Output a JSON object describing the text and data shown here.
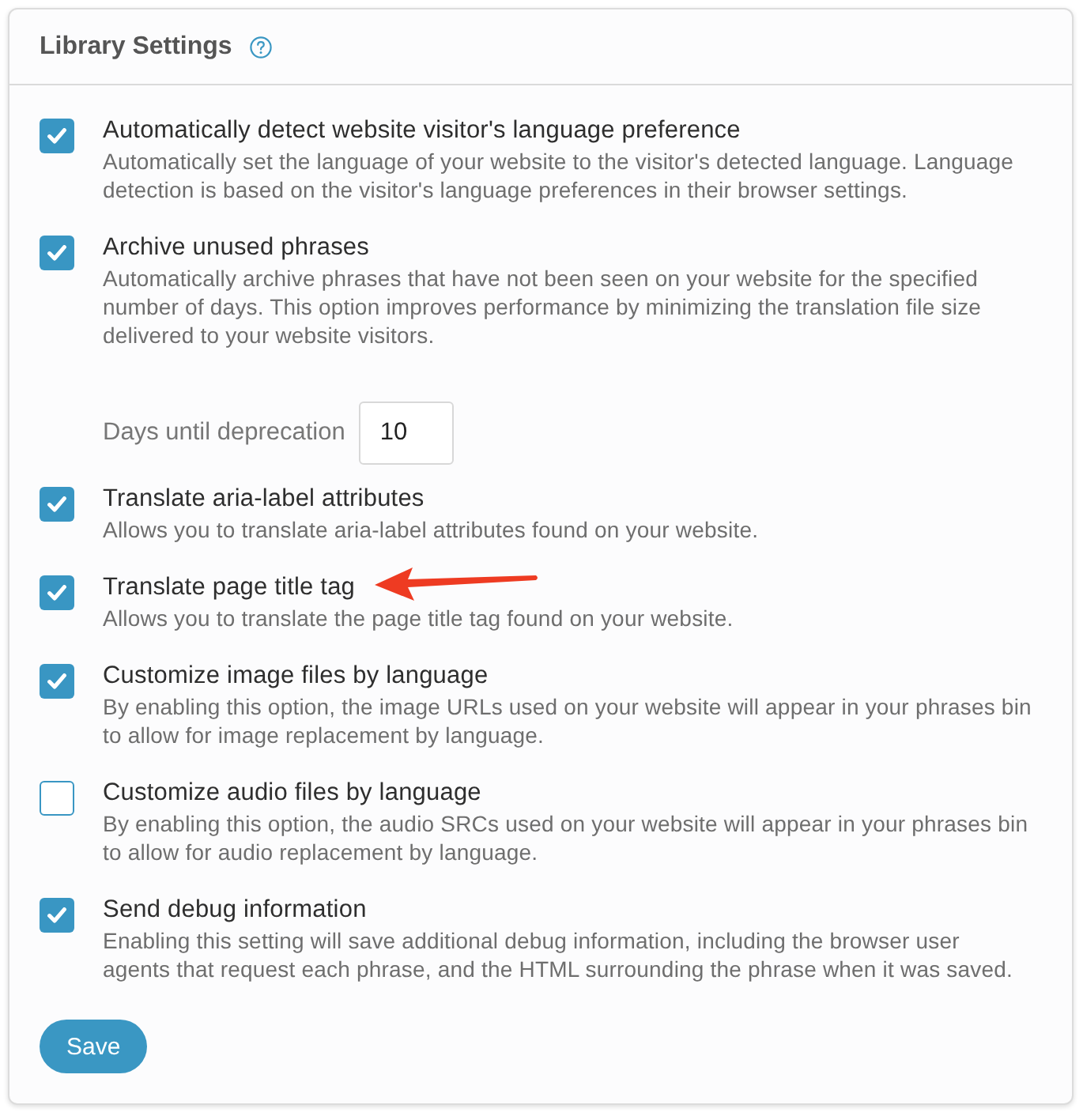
{
  "panel": {
    "title": "Library Settings"
  },
  "settings": [
    {
      "kind": "checkbox",
      "label": "Automatically detect website visitor's language preference",
      "description": "Automatically set the language of your website to the visitor's detected language. Language\ndetection is based on the visitor's language preferences in their browser settings.",
      "checked": true,
      "pointed": false
    },
    {
      "kind": "checkbox",
      "label": "Archive unused phrases",
      "description": "Automatically archive phrases that have not been seen on your website for the specified\nnumber of days. This option improves performance by minimizing the translation file size\ndelivered to your website visitors.",
      "checked": true,
      "pointed": false
    },
    {
      "kind": "number",
      "label": "Days until deprecation",
      "value": "10"
    },
    {
      "kind": "checkbox",
      "label": "Translate aria-label attributes",
      "description": "Allows you to translate aria-label attributes found on your website.",
      "checked": true,
      "pointed": false
    },
    {
      "kind": "checkbox",
      "label": "Translate page title tag",
      "description": "Allows you to translate the page title tag found on your website.",
      "checked": true,
      "pointed": true
    },
    {
      "kind": "checkbox",
      "label": "Customize image files by language",
      "description": "By enabling this option, the image URLs used on your website will appear in your phrases bin\nto allow for image replacement by language.",
      "checked": true,
      "pointed": false
    },
    {
      "kind": "checkbox",
      "label": "Customize audio files by language",
      "description": "By enabling this option, the audio SRCs used on your website will appear in your phrases bin\nto allow for audio replacement by language.",
      "checked": false,
      "pointed": false
    },
    {
      "kind": "checkbox",
      "label": "Send debug information",
      "description": "Enabling this setting will save additional debug information, including the browser user\nagents that request each phrase, and the HTML surrounding the phrase when it was saved.",
      "checked": true,
      "pointed": false
    }
  ],
  "save_button": {
    "label": "Save"
  }
}
